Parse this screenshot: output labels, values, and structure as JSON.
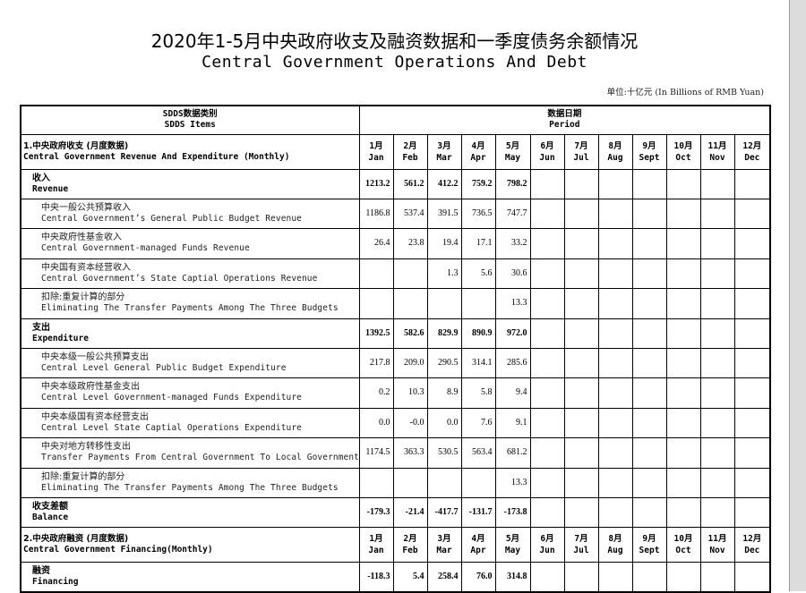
{
  "title_cn": "2020年1-5月中央政府收支及融资数据和一季度债务余额情况",
  "title_en": "Central Government Operations And Debt",
  "unit": "单位:十亿元 (In Billions of  RMB Yuan)",
  "header": {
    "items_cn": "SDDS数据类别",
    "items_en": "SDDS Items",
    "period_cn": "数据日期",
    "period_en": "Period"
  },
  "sections": [
    {
      "title_cn": "1.中央政府收支 (月度数据)",
      "title_en": "Central Government Revenue And Expenditure (Monthly)",
      "months": [
        {
          "n": "1月",
          "e": "Jan"
        },
        {
          "n": "2月",
          "e": "Feb"
        },
        {
          "n": "3月",
          "e": "Mar"
        },
        {
          "n": "4月",
          "e": "Apr"
        },
        {
          "n": "5月",
          "e": "May"
        },
        {
          "n": "6月",
          "e": "Jun"
        },
        {
          "n": "7月",
          "e": "Jul"
        },
        {
          "n": "8月",
          "e": "Aug"
        },
        {
          "n": "9月",
          "e": "Sept"
        },
        {
          "n": "10月",
          "e": "Oct"
        },
        {
          "n": "11月",
          "e": "Nov"
        },
        {
          "n": "12月",
          "e": "Dec"
        }
      ],
      "rows": [
        {
          "kind": "main",
          "cn": "收入",
          "en": "Revenue",
          "values": [
            "1213.2",
            "561.2",
            "412.2",
            "759.2",
            "798.2",
            "",
            "",
            "",
            "",
            "",
            "",
            ""
          ]
        },
        {
          "kind": "sub",
          "cn": "中央一般公共预算收入",
          "en": "Central Government’s General Public Budget Revenue",
          "values": [
            "1186.8",
            "537.4",
            "391.5",
            "736.5",
            "747.7",
            "",
            "",
            "",
            "",
            "",
            "",
            ""
          ]
        },
        {
          "kind": "sub",
          "cn": "中央政府性基金收入",
          "en": "Central Government-managed Funds Revenue",
          "values": [
            "26.4",
            "23.8",
            "19.4",
            "17.1",
            "33.2",
            "",
            "",
            "",
            "",
            "",
            "",
            ""
          ]
        },
        {
          "kind": "sub",
          "cn": "中央国有资本经营收入",
          "en": "Central Government’s State Captial Operations Revenue",
          "values": [
            "",
            "",
            "1.3",
            "5.6",
            "30.6",
            "",
            "",
            "",
            "",
            "",
            "",
            ""
          ]
        },
        {
          "kind": "sub",
          "cn": "扣除:重复计算的部分",
          "en": "Eliminating The Transfer Payments Among The Three Budgets",
          "values": [
            "",
            "",
            "",
            "",
            "13.3",
            "",
            "",
            "",
            "",
            "",
            "",
            ""
          ]
        },
        {
          "kind": "main",
          "cn": "支出",
          "en": "Expenditure",
          "values": [
            "1392.5",
            "582.6",
            "829.9",
            "890.9",
            "972.0",
            "",
            "",
            "",
            "",
            "",
            "",
            ""
          ]
        },
        {
          "kind": "sub",
          "cn": "中央本级一般公共预算支出",
          "en": "Central Level General Public Budget Expenditure",
          "values": [
            "217.8",
            "209.0",
            "290.5",
            "314.1",
            "285.6",
            "",
            "",
            "",
            "",
            "",
            "",
            ""
          ]
        },
        {
          "kind": "sub",
          "cn": "中央本级政府性基金支出",
          "en": "Central Level Government-managed Funds Expenditure",
          "values": [
            "0.2",
            "10.3",
            "8.9",
            "5.8",
            "9.4",
            "",
            "",
            "",
            "",
            "",
            "",
            ""
          ]
        },
        {
          "kind": "sub",
          "cn": "中央本级国有资本经营支出",
          "en": "Central Level State Captial Operations Expenditure",
          "values": [
            "0.0",
            "-0.0",
            "0.0",
            "7.6",
            "9.1",
            "",
            "",
            "",
            "",
            "",
            "",
            ""
          ]
        },
        {
          "kind": "sub",
          "cn": "中央对地方转移性支出",
          "en": "Transfer Payments From Central Government To Local Governments",
          "values": [
            "1174.5",
            "363.3",
            "530.5",
            "563.4",
            "681.2",
            "",
            "",
            "",
            "",
            "",
            "",
            ""
          ]
        },
        {
          "kind": "sub",
          "cn": "扣除:重复计算的部分",
          "en": "Eliminating The Transfer Payments Among The Three Budgets",
          "values": [
            "",
            "",
            "",
            "",
            "13.3",
            "",
            "",
            "",
            "",
            "",
            "",
            ""
          ]
        },
        {
          "kind": "main",
          "cn": "收支差额",
          "en": "Balance",
          "values": [
            "-179.3",
            "-21.4",
            "-417.7",
            "-131.7",
            "-173.8",
            "",
            "",
            "",
            "",
            "",
            "",
            ""
          ]
        }
      ]
    },
    {
      "title_cn": "2.中央政府融资 (月度数据)",
      "title_en": "Central Government Financing(Monthly)",
      "months": [
        {
          "n": "1月",
          "e": "Jan"
        },
        {
          "n": "2月",
          "e": "Feb"
        },
        {
          "n": "3月",
          "e": "Mar"
        },
        {
          "n": "4月",
          "e": "Apr"
        },
        {
          "n": "5月",
          "e": "May"
        },
        {
          "n": "6月",
          "e": "Jun"
        },
        {
          "n": "7月",
          "e": "Jul"
        },
        {
          "n": "8月",
          "e": "Aug"
        },
        {
          "n": "9月",
          "e": "Sept"
        },
        {
          "n": "10月",
          "e": "Oct"
        },
        {
          "n": "11月",
          "e": "Nov"
        },
        {
          "n": "12月",
          "e": "Dec"
        }
      ],
      "rows": [
        {
          "kind": "main",
          "cn": "融资",
          "en": "Financing",
          "values": [
            "-118.3",
            "5.4",
            "258.4",
            "76.0",
            "314.8",
            "",
            "",
            "",
            "",
            "",
            "",
            ""
          ]
        }
      ]
    }
  ]
}
